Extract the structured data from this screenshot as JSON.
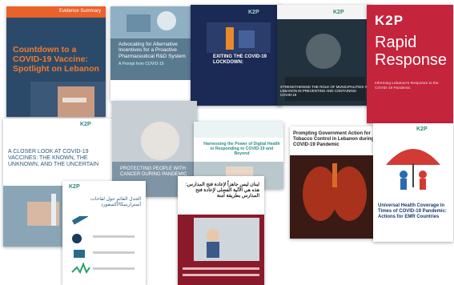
{
  "covers": {
    "c1": {
      "logo": "",
      "tag": "Evidence Summary",
      "title": "Countdown to a COVID-19 Vaccine: Spotlight on Lebanon"
    },
    "c2": {
      "title": "Advocating for Alternative Incentives for a Proactive Pharmaceutical R&D System",
      "sub": "A Prompt from COVID-19"
    },
    "c3": {
      "logo": "K2P",
      "title": "EXITING THE COVID-19 LOCKDOWN:"
    },
    "c4": {
      "logo": "K2P",
      "title": "STRENGTHENING THE ROLE OF MUNICIPALITIES IN LEBANON IN PREVENTING AND CONTAINING COVID-19"
    },
    "c5": {
      "logo": "K2P",
      "line1": "Rapid",
      "line2": "Response",
      "sub": "Informing Lebanon's Response to the COVID-19 Pandemic"
    },
    "c6": {
      "logo": "K2P",
      "title": "A CLOSER LOOK AT COVID-19 VACCINES: THE KNOWN, THE UNKNOWN, AND THE UNCERTAIN"
    },
    "c7": {
      "title": "PROTECTING PEOPLE WITH CANCER DURING PANDEMIC"
    },
    "c8": {
      "title": "Harnessing the Power of Digital Health in Responding to COVID-19 and Beyond"
    },
    "c9": {
      "title": "Prompting Government Action for Tobacco Control in Lebanon during COVID-19 Pandemic"
    },
    "c10": {
      "logo": "K2P",
      "title": "Universal Health Coverage in Times of COVID-19 Pandemic: Actions for EMR Countries"
    },
    "c11": {
      "logo": "K2P",
      "title": "الجدل القائم حول لقاحات أسترازينيكا/أكسفورد"
    },
    "c12": {
      "title": "لبنان ليس جاهزاً لإعادة فتح المدارس: هذه هي الآلية الفضلى لإعادة فتح المدارس بطريقة آمنة"
    }
  },
  "colors": {
    "k2p_teal": "#2a8a7a",
    "rapid_red": "#c4243c",
    "evidence_orange": "#e9622a"
  }
}
